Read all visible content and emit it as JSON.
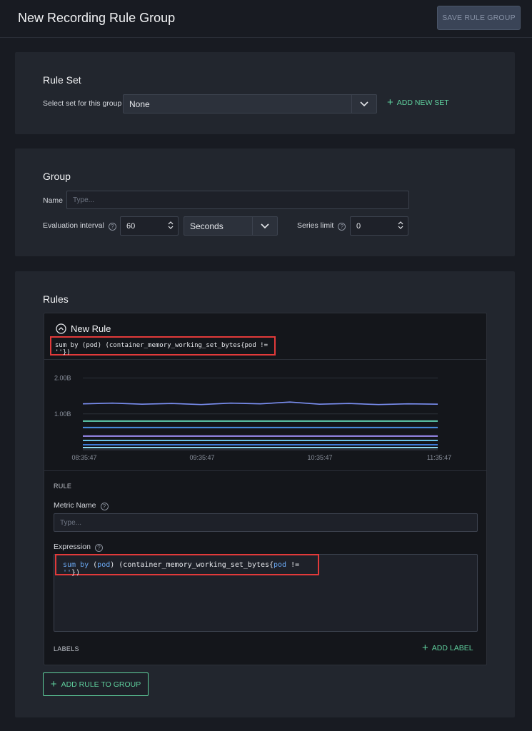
{
  "header": {
    "title": "New Recording Rule Group",
    "save_label": "SAVE RULE GROUP"
  },
  "rule_set": {
    "title": "Rule Set",
    "select_label": "Select set for this group",
    "selected": "None",
    "add_label": "ADD NEW SET"
  },
  "group": {
    "title": "Group",
    "name_label": "Name",
    "name_placeholder": "Type...",
    "interval_label": "Evaluation interval",
    "interval_value": "60",
    "unit_selected": "Seconds",
    "series_limit_label": "Series limit",
    "series_limit_value": "0"
  },
  "rules": {
    "title": "Rules",
    "rule_title": "New Rule",
    "query": "sum by (pod) (container_memory_working_set_bytes{pod != ''})",
    "rule_section_label": "RULE",
    "metric_name_label": "Metric Name",
    "metric_name_placeholder": "Type...",
    "expression_label": "Expression",
    "expression": {
      "p1": "sum by",
      "p2": " (",
      "p3": "pod",
      "p4": ") (container_memory_working_set_bytes{",
      "p5": "pod",
      "p6": " != ",
      "p7": "''",
      "p8": "})"
    },
    "labels_label": "LABELS",
    "add_label": "ADD LABEL",
    "add_rule_label": "ADD RULE TO GROUP"
  },
  "chart_data": {
    "type": "line",
    "x_ticks": [
      "08:35:47",
      "09:35:47",
      "10:35:47",
      "11:35:47"
    ],
    "y_ticks": [
      "2.00B",
      "1.00B"
    ],
    "ylim": [
      0,
      2.15
    ],
    "x": [
      0,
      1,
      2,
      3,
      4,
      5,
      6,
      7,
      8,
      9,
      10,
      11,
      12
    ],
    "series": [
      {
        "color": "#7b8ff2",
        "values": [
          1.28,
          1.3,
          1.27,
          1.29,
          1.26,
          1.3,
          1.28,
          1.33,
          1.27,
          1.29,
          1.26,
          1.28,
          1.27
        ]
      },
      {
        "color": "#5fd1b0",
        "values": [
          0.8,
          0.8,
          0.8,
          0.8,
          0.8,
          0.8,
          0.8,
          0.8,
          0.8,
          0.8,
          0.8,
          0.8,
          0.8
        ]
      },
      {
        "color": "#4a90e2",
        "values": [
          0.62,
          0.62,
          0.62,
          0.62,
          0.62,
          0.62,
          0.62,
          0.62,
          0.62,
          0.62,
          0.62,
          0.62,
          0.62
        ]
      },
      {
        "color": "#9b8cf2",
        "values": [
          0.38,
          0.38,
          0.38,
          0.38,
          0.38,
          0.38,
          0.38,
          0.38,
          0.38,
          0.38,
          0.38,
          0.38,
          0.38
        ]
      },
      {
        "color": "#6cc3e8",
        "values": [
          0.26,
          0.26,
          0.26,
          0.26,
          0.26,
          0.26,
          0.26,
          0.26,
          0.26,
          0.26,
          0.26,
          0.26,
          0.26
        ]
      },
      {
        "color": "#3d7bd9",
        "values": [
          0.14,
          0.14,
          0.14,
          0.14,
          0.14,
          0.14,
          0.14,
          0.14,
          0.14,
          0.14,
          0.14,
          0.14,
          0.14
        ]
      },
      {
        "color": "#8fd9f0",
        "values": [
          0.06,
          0.06,
          0.06,
          0.06,
          0.06,
          0.06,
          0.06,
          0.06,
          0.06,
          0.06,
          0.06,
          0.06,
          0.06
        ]
      }
    ]
  }
}
